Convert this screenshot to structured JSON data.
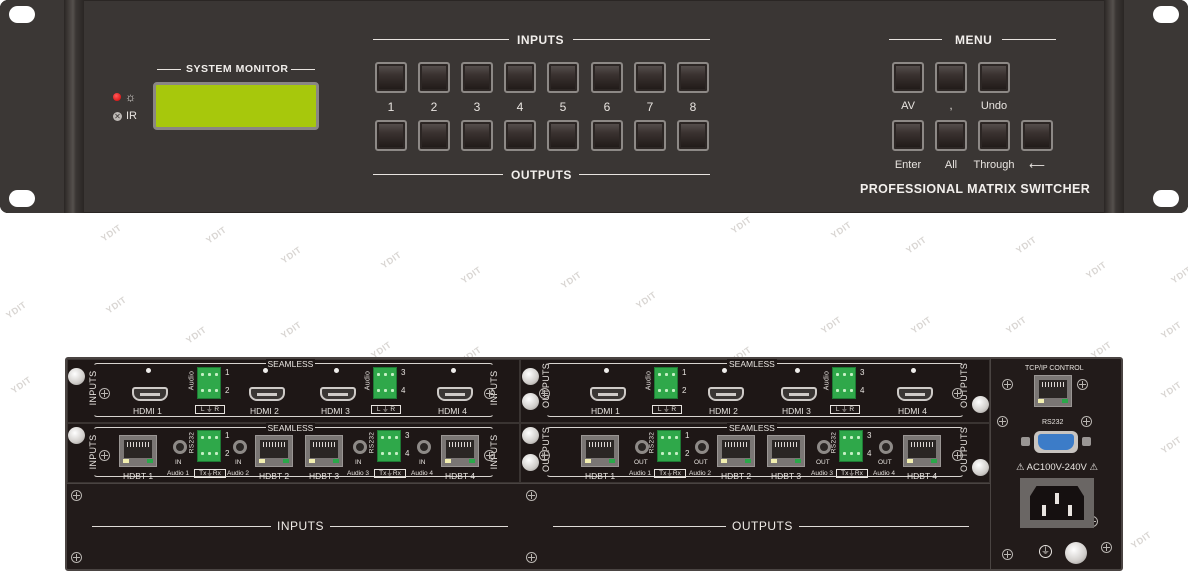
{
  "front_panel": {
    "system_monitor_label": "SYSTEM MONITOR",
    "indicators": {
      "power_icon": "sun-icon",
      "ir_label": "IR"
    },
    "lcd_color": "#a7c80c",
    "inputs_label": "INPUTS",
    "outputs_label": "OUTPUTS",
    "input_numbers": [
      "1",
      "2",
      "3",
      "4",
      "5",
      "6",
      "7",
      "8"
    ],
    "menu_label": "MENU",
    "menu_row1": [
      "AV",
      ",",
      "Undo"
    ],
    "menu_row2": [
      "Enter",
      "All",
      "Through",
      "⟵"
    ],
    "brand": "PROFESSIONAL MATRIX SWITCHER"
  },
  "watermark": "YDIT",
  "rear_panel": {
    "seamless_label": "SEAMLESS",
    "inputs_label": "INPUTS",
    "outputs_label": "OUTPUTS",
    "audio_label": "Audio",
    "rs232_label": "RS232",
    "lr_label": "L ⏚ R",
    "txrx_label": "Tx⏚Rx",
    "in_label": "IN",
    "out_label": "OUT",
    "hdmi_inputs": [
      "HDMI 1",
      "HDMI 2",
      "HDMI 3",
      "HDMI 4"
    ],
    "hdmi_outputs": [
      "HDMI 1",
      "HDMI 2",
      "HDMI 3",
      "HDMI 4"
    ],
    "hdbt_inputs": [
      "HDBT 1",
      "HDBT 2",
      "HDBT 3",
      "HDBT 4"
    ],
    "hdbt_outputs": [
      "HDBT 1",
      "HDBT 2",
      "HDBT 3",
      "HDBT 4"
    ],
    "audio_ports": [
      "Audio 1",
      "Audio 2",
      "Audio 3",
      "Audio 4"
    ],
    "terminal_numbers": [
      "1",
      "2",
      "3",
      "4"
    ],
    "blank_inputs_label": "INPUTS",
    "blank_outputs_label": "OUTPUTS",
    "tcpip_label": "TCP/IP CONTROL",
    "rs232_port_label": "RS232",
    "power_label": "⚠ AC100V-240V ⚠"
  }
}
